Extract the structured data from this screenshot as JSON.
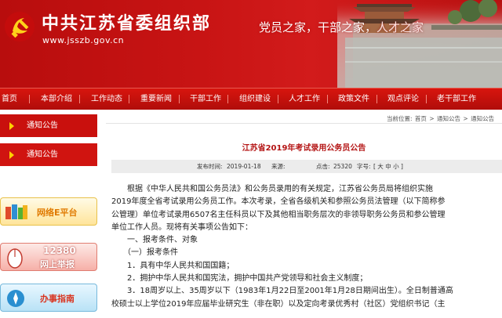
{
  "header": {
    "title": "中共江苏省委组织部",
    "url": "www.jsszb.gov.cn",
    "slogan_parts": [
      "党员之家，",
      "干部之家，",
      "人才之家"
    ]
  },
  "nav": {
    "items": [
      "首页",
      "本部介绍",
      "工作动态",
      "重要新闻",
      "干部工作",
      "组织建设",
      "人才工作",
      "政策文件",
      "观点评论",
      "老干部工作"
    ]
  },
  "sidebar": {
    "tab1": "通知公告",
    "tab2": "通知公告",
    "card1": "网络E平台",
    "card2_line1": "12380",
    "card2_line2": "网上举报",
    "card3": "办事指南"
  },
  "breadcrumb": {
    "prefix": "当前位置:",
    "items": [
      "首页",
      "通知公告",
      "通知公告"
    ],
    "separator": ">"
  },
  "article": {
    "title": "江苏省2019年考试录用公务员公告",
    "meta": {
      "date_label": "发布时间:",
      "date": "2019-01-18",
      "source_label": "来源:",
      "source": "",
      "hits_label": "点击:",
      "hits": "25320",
      "font_label": "字号:",
      "font_sizes": "[ 大 中 小 ]"
    },
    "paragraphs": [
      "　　根据《中华人民共和国公务员法》和公务员录用的有关规定，江苏省公务员局将组织实施",
      "2019年度全省考试录用公务员工作。本次考录，全省各级机关和参照公务员法管理（以下简称参",
      "公管理）单位考试录用6507名主任科员以下及其他相当职务层次的非领导职务公务员和参公管理",
      "单位工作人员。现将有关事项公告如下：",
      "　　一、报考条件、对象",
      "　　（一）报考条件",
      "　　1．具有中华人民共和国国籍；",
      "　　2．拥护中华人民共和国宪法，拥护中国共产党领导和社会主义制度；",
      "　　3．18周岁以上、35周岁以下（1983年1月22日至2001年1月28日期间出生）。全日制普通高",
      "校硕士以上学位2019年应届毕业研究生（非在职）以及定向考录优秀村（社区）党组织书记（主"
    ]
  },
  "colors": {
    "brand_red": "#c81414",
    "title_red": "#b41414"
  }
}
